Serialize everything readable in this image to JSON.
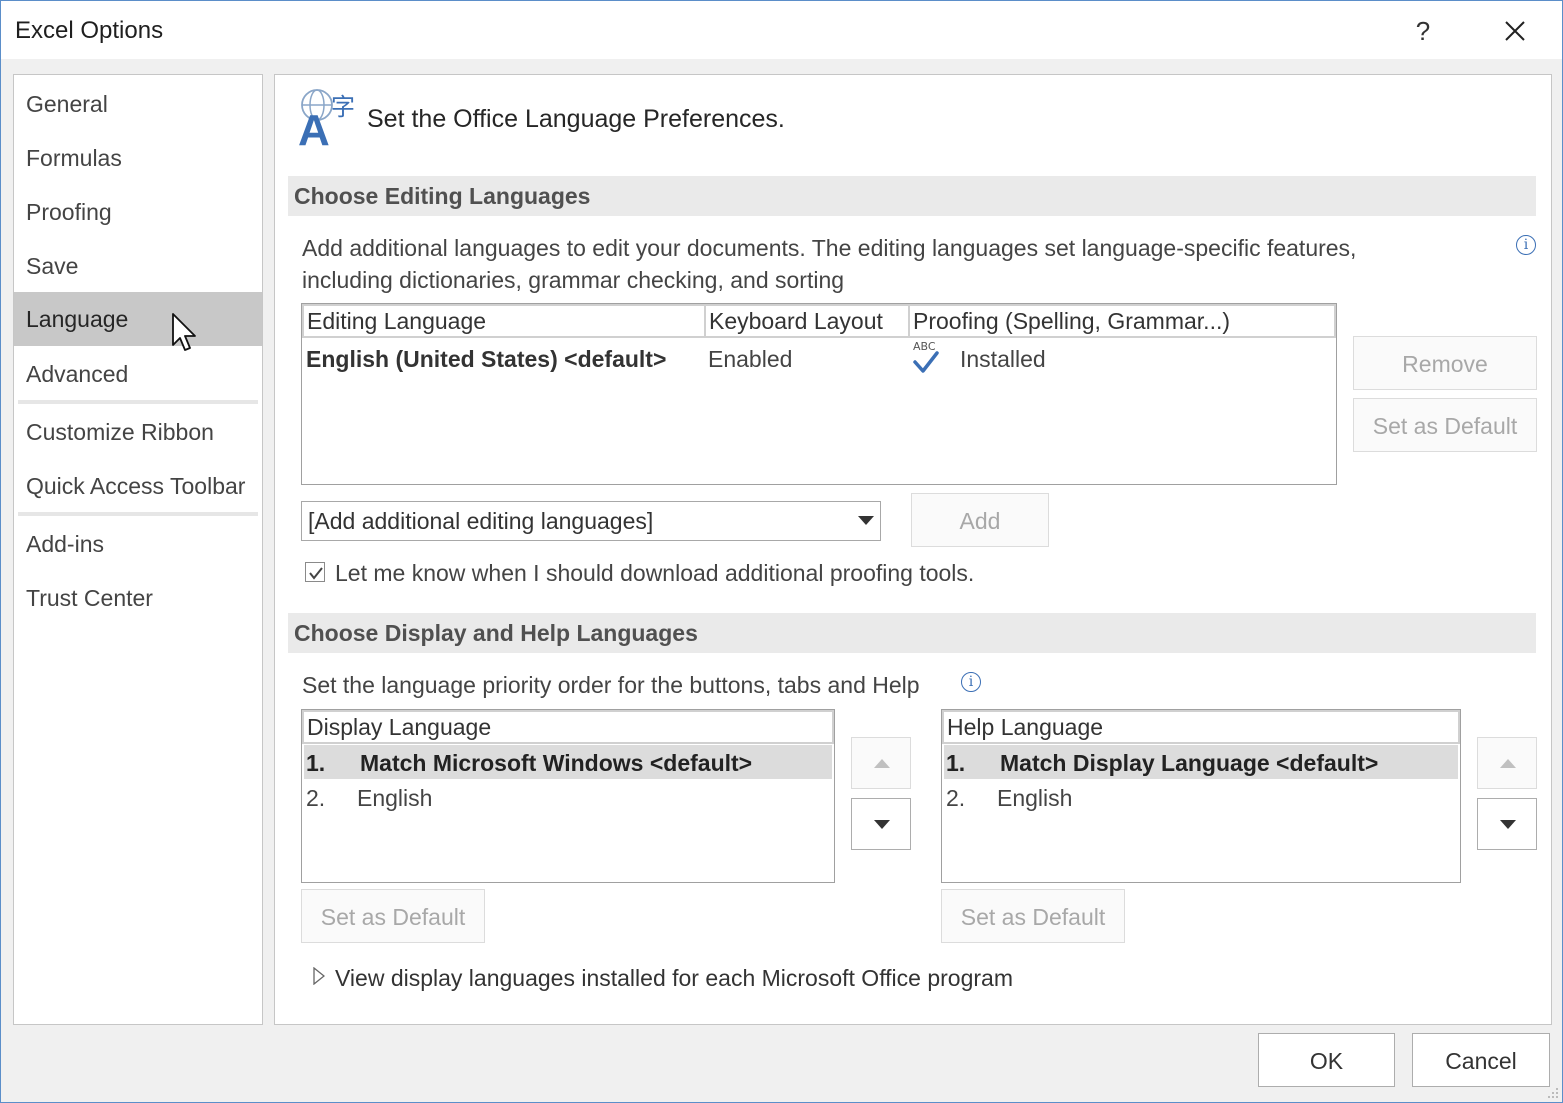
{
  "window": {
    "title": "Excel Options",
    "help_glyph": "?"
  },
  "nav": {
    "items": [
      {
        "label": "General"
      },
      {
        "label": "Formulas"
      },
      {
        "label": "Proofing"
      },
      {
        "label": "Save"
      },
      {
        "label": "Language",
        "selected": true
      },
      {
        "label": "Advanced"
      },
      {
        "label": "Customize Ribbon"
      },
      {
        "label": "Quick Access Toolbar"
      },
      {
        "label": "Add-ins"
      },
      {
        "label": "Trust Center"
      }
    ]
  },
  "header": {
    "title": "Set the Office Language Preferences.",
    "icon": "language-icon"
  },
  "editing": {
    "section_title": "Choose Editing Languages",
    "description_line1": "Add additional languages to edit your documents. The editing languages set language-specific features,",
    "description_line2": "including dictionaries, grammar checking, and sorting",
    "columns": [
      "Editing Language",
      "Keyboard Layout",
      "Proofing (Spelling, Grammar...)"
    ],
    "rows": [
      {
        "language": "English (United States) <default>",
        "keyboard": "Enabled",
        "proofing": "Installed",
        "proofing_icon_text": "ABC"
      }
    ],
    "remove_label": "Remove",
    "set_default_label": "Set as Default",
    "add_combo_value": "[Add additional editing languages]",
    "add_label": "Add",
    "download_check_label": "Let me know when I should download additional proofing tools.",
    "download_checked": true
  },
  "display": {
    "section_title": "Choose Display and Help Languages",
    "description": "Set the language priority order for the buttons, tabs and Help",
    "display_list": {
      "header": "Display Language",
      "items": [
        {
          "num": "1.",
          "label": "Match Microsoft Windows <default>"
        },
        {
          "num": "2.",
          "label": "English"
        }
      ]
    },
    "help_list": {
      "header": "Help Language",
      "items": [
        {
          "num": "1.",
          "label": "Match Display Language <default>"
        },
        {
          "num": "2.",
          "label": "English"
        }
      ]
    },
    "set_default_label": "Set as Default",
    "view_link": "View display languages installed for each Microsoft Office program"
  },
  "footer": {
    "ok_label": "OK",
    "cancel_label": "Cancel"
  },
  "colors": {
    "accent": "#3b6fb5",
    "selection": "#c8c8c8",
    "band": "#eaeaea"
  }
}
